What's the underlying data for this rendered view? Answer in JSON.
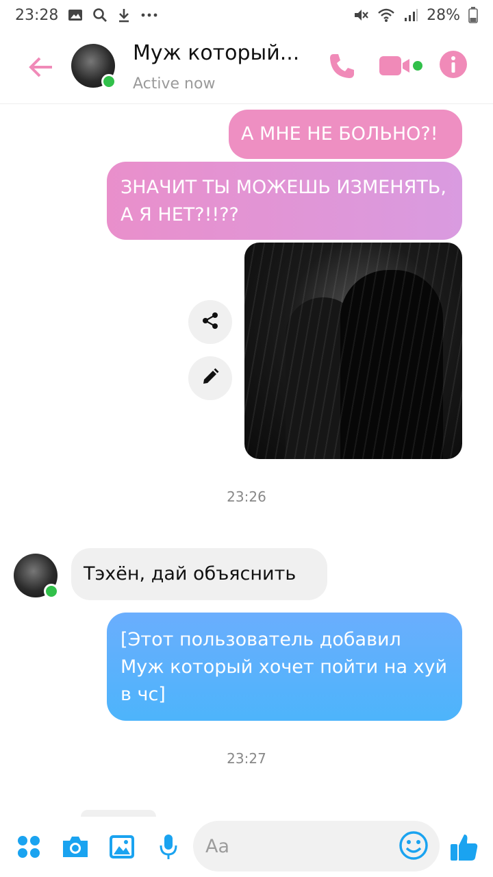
{
  "status_bar": {
    "time": "23:28",
    "battery": "28%"
  },
  "header": {
    "title": "Муж который...",
    "subtitle": "Active now",
    "online": true
  },
  "messages": [
    {
      "side": "right",
      "text": "А МНЕ НЕ БОЛЬНО?!"
    },
    {
      "side": "right",
      "text": "ЗНАЧИТ ТЫ МОЖЕШЬ ИЗМЕНЯТЬ, А Я НЕТ?!!??"
    },
    {
      "side": "right",
      "type": "image"
    },
    {
      "type": "timestamp",
      "text": "23:26"
    },
    {
      "side": "left",
      "text": "Тэхён, дай объяснить"
    },
    {
      "side": "right",
      "text": "[Этот пользователь добавил Муж который хочет пойти на хуй в чс]"
    },
    {
      "type": "timestamp",
      "text": "23:27"
    }
  ],
  "composer": {
    "placeholder": "Aa"
  },
  "colors": {
    "accent_pink": "#ee8fc2",
    "header_pink": "#f08ab8",
    "blue_bubble": "#55b0fc",
    "composer_blue": "#1aa3f0",
    "online_green": "#31c04a"
  }
}
